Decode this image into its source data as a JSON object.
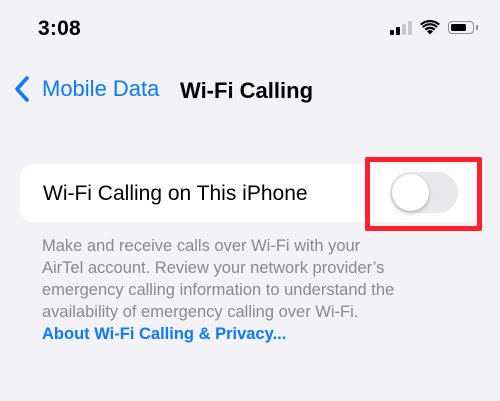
{
  "status_bar": {
    "time": "3:08"
  },
  "nav": {
    "back_label": "Mobile Data",
    "title": "Wi-Fi Calling"
  },
  "settings": {
    "wifi_calling_label": "Wi-Fi Calling on This iPhone",
    "wifi_calling_enabled": false
  },
  "description": {
    "lines": [
      "Make and receive calls over Wi-Fi with your",
      "AirTel account. Review your network provider’s",
      "emergency calling information to understand the",
      "availability of emergency calling over Wi-Fi."
    ],
    "link": "About Wi-Fi Calling & Privacy..."
  },
  "colors": {
    "accent": "#0a7aff",
    "highlight": "#ff1f2d",
    "background": "#f2f2f7"
  },
  "icons": {
    "back": "chevron-left-icon",
    "signal": "cellular-signal-icon",
    "wifi": "wifi-icon",
    "battery": "battery-icon"
  }
}
